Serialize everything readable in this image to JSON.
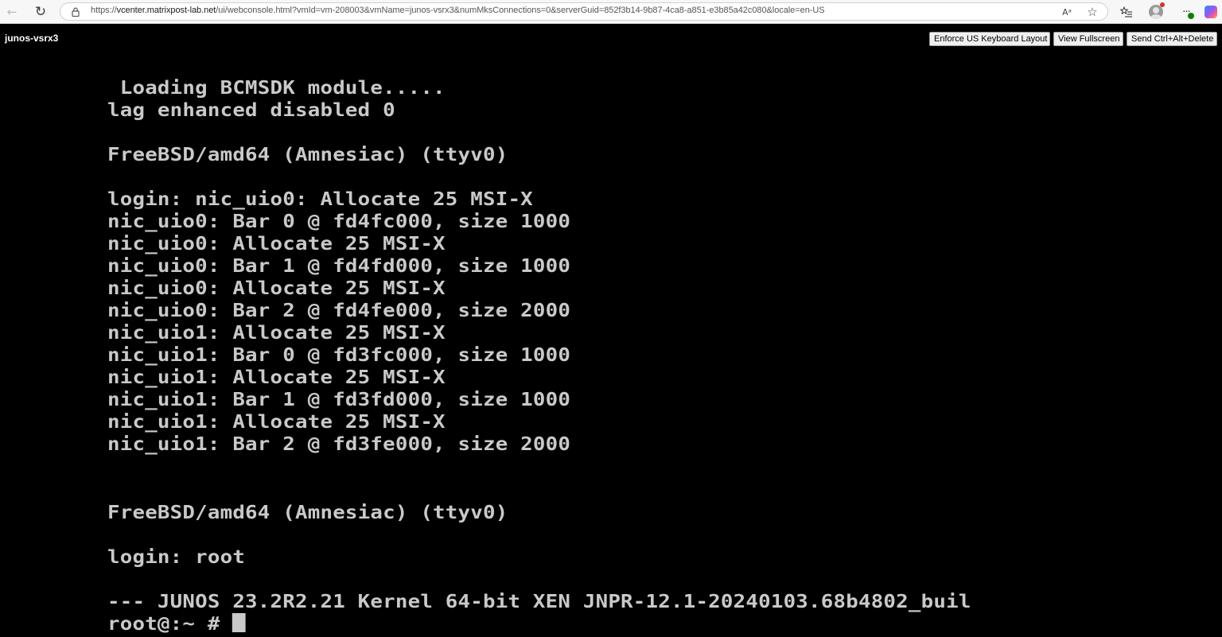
{
  "browser": {
    "url_prefix": "https://",
    "url_host": "vcenter.matrixpost-lab.net",
    "url_rest": "/ui/webconsole.html?vmId=vm-208003&vmName=junos-vsrx3&numMksConnections=0&serverGuid=852f3b14-9b87-4ca8-a851-e3b85a42c080&locale=en-US",
    "read_aloud_glyph": "Aᵃ",
    "favorite_glyph": "☆",
    "favorites_glyph": "☰"
  },
  "console": {
    "vm_name": "junos-vsrx3",
    "buttons": {
      "keyboard_layout": "Enforce US Keyboard Layout",
      "fullscreen": "View Fullscreen",
      "ctrl_alt_delete": "Send Ctrl+Alt+Delete"
    }
  },
  "terminal": {
    "lines": [
      " Loading BCMSDK module.....",
      "lag enhanced disabled 0",
      "",
      "FreeBSD/amd64 (Amnesiac) (ttyv0)",
      "",
      "login: nic_uio0: Allocate 25 MSI-X",
      "nic_uio0: Bar 0 @ fd4fc000, size 1000",
      "nic_uio0: Allocate 25 MSI-X",
      "nic_uio0: Bar 1 @ fd4fd000, size 1000",
      "nic_uio0: Allocate 25 MSI-X",
      "nic_uio0: Bar 2 @ fd4fe000, size 2000",
      "nic_uio1: Allocate 25 MSI-X",
      "nic_uio1: Bar 0 @ fd3fc000, size 1000",
      "nic_uio1: Allocate 25 MSI-X",
      "nic_uio1: Bar 1 @ fd3fd000, size 1000",
      "nic_uio1: Allocate 25 MSI-X",
      "nic_uio1: Bar 2 @ fd3fe000, size 2000",
      "",
      "",
      "FreeBSD/amd64 (Amnesiac) (ttyv0)",
      "",
      "login: root",
      "",
      "--- JUNOS 23.2R2.21 Kernel 64-bit XEN JNPR-12.1-20240103.68b4802_buil",
      "root@:~ # "
    ]
  },
  "colors": {
    "terminal_bg": "#000000",
    "terminal_fg": "#c9c9c9",
    "chrome_bg": "#f7f7f7"
  }
}
